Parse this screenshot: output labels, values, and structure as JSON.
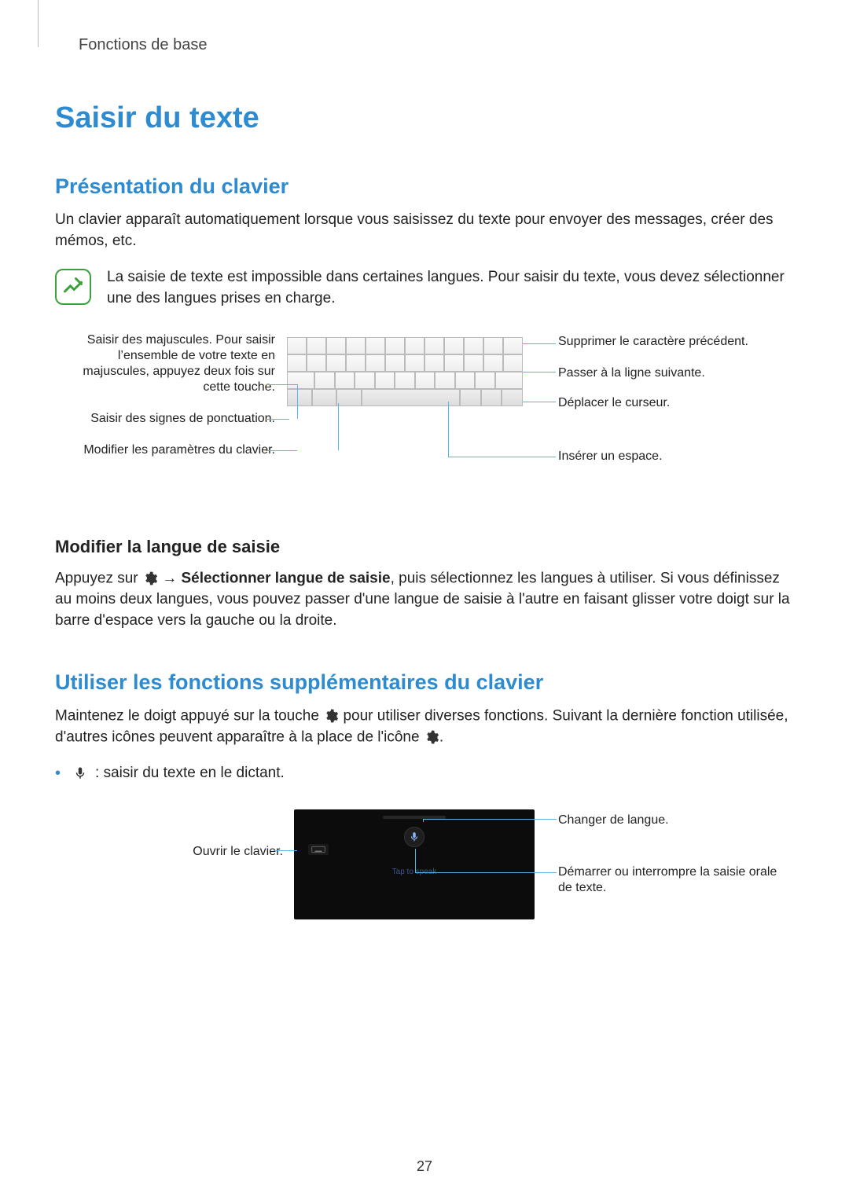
{
  "header": {
    "category": "Fonctions de base"
  },
  "title": "Saisir du texte",
  "section1": {
    "heading": "Présentation du clavier",
    "intro": "Un clavier apparaît automatiquement lorsque vous saisissez du texte pour envoyer des messages, créer des mémos, etc.",
    "note": "La saisie de texte est impossible dans certaines langues. Pour saisir du texte, vous devez sélectionner une des langues prises en charge.",
    "callouts_left": {
      "caps": "Saisir des majuscules. Pour saisir l’ensemble de votre texte en majuscules, appuyez deux fois sur cette touche.",
      "punct": "Saisir des signes de ponctuation.",
      "settings": "Modifier les paramètres du clavier."
    },
    "callouts_right": {
      "del": "Supprimer le caractère précédent.",
      "enter": "Passer à la ligne suivante.",
      "cursor": "Déplacer le curseur.",
      "space": "Insérer un espace."
    },
    "sub_heading": "Modifier la langue de saisie",
    "sub_text_pre": "Appuyez sur ",
    "sub_text_mid1": " → ",
    "sub_text_bold": "Sélectionner langue de saisie",
    "sub_text_post": ", puis sélectionnez les langues à utiliser. Si vous définissez au moins deux langues, vous pouvez passer d'une langue de saisie à l'autre en faisant glisser votre doigt sur la barre d'espace vers la gauche ou la droite."
  },
  "section2": {
    "heading": "Utiliser les fonctions supplémentaires du clavier",
    "text_pre": "Maintenez le doigt appuyé sur la touche ",
    "text_mid": " pour utiliser diverses fonctions. Suivant la dernière fonction utilisée, d'autres icônes peuvent apparaître à la place de l'icône ",
    "text_post": ".",
    "bullet1": " : saisir du texte en le dictant.",
    "callouts_left": {
      "open_kbd": "Ouvrir le clavier."
    },
    "callouts_right": {
      "lang": "Changer de langue.",
      "voice": "Démarrer ou interrompre la saisie orale de texte."
    },
    "dark_tap_label": "Tap to speak"
  },
  "page_number": "27"
}
